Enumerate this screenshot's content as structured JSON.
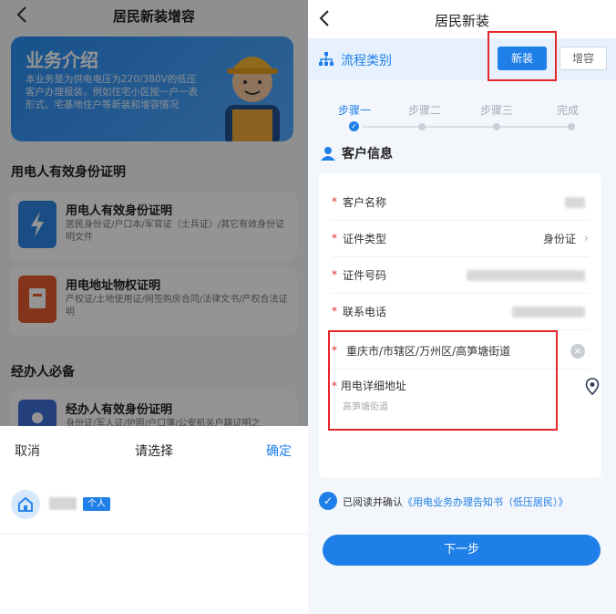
{
  "left": {
    "nav": {
      "title": "居民新装增容",
      "back_icon": "chevron-left-icon"
    },
    "banner": {
      "title": "业务介绍",
      "description": "本业务是为供电电压为220/380V的低压客户办理报装，例如住宅小区按一户一表形式、宅基地住户等新装和增容情况"
    },
    "section1_title": "用电人有效身份证明",
    "cards": [
      {
        "title": "用电人有效身份证明",
        "desc": "居民身份证/户口本/军官证（士兵证）/其它有效身份证明文件",
        "icon": "lightning-doc-icon",
        "color": "#2f86e6"
      },
      {
        "title": "用电地址物权证明",
        "desc": "产权证/土地使用证/网签购房合同/法律文书/产权合法证明",
        "icon": "property-doc-icon",
        "color": "#e35a2b"
      },
      {
        "title": "经办人有效身份证明",
        "desc": "身份证/军人证/护照/户口簿/公安机关户籍证明之",
        "icon": "person-doc-icon",
        "color": "#3d6fd8"
      }
    ],
    "section2_title": "经办人必备",
    "sheet": {
      "cancel": "取消",
      "title": "请选择",
      "confirm": "确定",
      "badge": "个人",
      "avatar_icon": "home-icon"
    }
  },
  "right": {
    "nav": {
      "title": "居民新装",
      "back_icon": "chevron-left-icon"
    },
    "flow": {
      "label": "流程类别",
      "icon": "hierarchy-icon",
      "btn_new": "新装",
      "btn_add": "增容"
    },
    "steps": [
      "步骤一",
      "步骤二",
      "步骤三",
      "完成"
    ],
    "active_step": 0,
    "customer_title": "客户信息",
    "fields": [
      {
        "label": "客户名称",
        "value": ""
      },
      {
        "label": "证件类型",
        "value": "身份证"
      },
      {
        "label": "证件号码",
        "value": ""
      },
      {
        "label": "联系电话",
        "value": ""
      }
    ],
    "address": "重庆市/市辖区/万州区/高笋塘街道",
    "detail_label": "用电详细地址",
    "detail_placeholder": "高笋塘街道",
    "agree_prefix": "已阅读并确认",
    "agree_link": "《用电业务办理告知书（低压居民）》",
    "next": "下一步",
    "accent": "#1e7fe8",
    "highlight": "#e5262a"
  }
}
